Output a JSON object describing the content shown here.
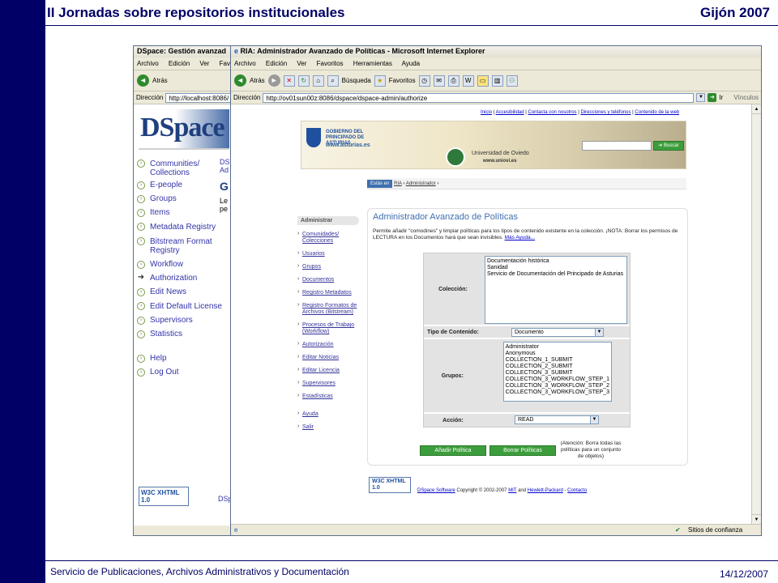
{
  "slide": {
    "title": "II Jornadas sobre repositorios institucionales",
    "city": "Gijón 2007",
    "footer_left": "Servicio de Publicaciones, Archivos Administrativos y Documentación",
    "footer_date": "14/12/2007"
  },
  "back_window": {
    "title": "DSpace: Gestión avanzad",
    "menu": [
      "Archivo",
      "Edición",
      "Ver",
      "Favorito"
    ],
    "back_label": "Atrás",
    "address_label": "Dirección",
    "address": "http://localhost:8086/",
    "logo": "DSpace",
    "nav": [
      "Communities/ Collections",
      "E-people",
      "Groups",
      "Items",
      "Metadata Registry",
      "Bitstream Format Registry",
      "Workflow",
      "Authorization",
      "Edit News",
      "Edit Default License",
      "Supervisors",
      "Statistics",
      "Help",
      "Log Out"
    ],
    "content_ds": "DS",
    "content_ad": "Ad",
    "content_g": "G",
    "content_le": "Le",
    "content_pe": "pe",
    "w3c_badge": "W3C XHTML 1.0",
    "footer_link": "DSp"
  },
  "front_window": {
    "title": "RIA: Administrador Avanzado de Políticas - Microsoft Internet Explorer",
    "menu": [
      "Archivo",
      "Edición",
      "Ver",
      "Favoritos",
      "Herramientas",
      "Ayuda"
    ],
    "back_label": "Atrás",
    "search_label": "Búsqueda",
    "favorites_label": "Favoritos",
    "address_label": "Dirección",
    "address": "http://ov01sun00z:8086/dspace/dspace-admin/authorize",
    "go_label": "Ir",
    "links_label": "Vínculos",
    "status_text": "Sitios de confianza",
    "toplinks": [
      "Inicio",
      "Accesibilidad",
      "Contacta con nosotros",
      "Direcciones y teléfonos",
      "Contenido de la web"
    ],
    "gov_logo": "GOBIERNO DEL PRINCIPADO DE ASTURIAS",
    "gov_url": "www.asturias.es",
    "uni_logo": "Universidad de Oviedo",
    "uni_url": "www.uniovi.es",
    "search_button": "Buscar",
    "breadcrumb": {
      "label": "Estás en",
      "items": [
        "RIA",
        "Administrador"
      ]
    },
    "sidebar_title": "Administrar",
    "sidebar": [
      "Comunidades/ Colecciones",
      "Usuarios",
      "Grupos",
      "Documentos",
      "Registro Metadatos",
      "Registro Formatos de Archivos (Bitstream)",
      "Procesos de Trabajo (Workflow)",
      "Autorización",
      "Editar Noticias",
      "Editar Licencia",
      "Supervisores",
      "Estadísticas",
      "Ayuda",
      "Salir"
    ],
    "page_heading": "Administrador Avanzado de Políticas",
    "intro": "Permite añadir \"comodines\" y limpiar políticas para los tipos de contenido existente en la colección. ¡NOTA: Borrar los permisos de LECTURA en los Documentos hará que sean invisibles.",
    "more_help": "Más Ayuda...",
    "form": {
      "collection_label": "Colección:",
      "collections": [
        "Documentación histórica",
        "Sanidad",
        "Servicio de Documentación del Principado de Asturias"
      ],
      "content_type_label": "Tipo de Contenido:",
      "content_type_value": "Documento",
      "groups_label": "Grupos:",
      "groups": [
        "Administrator",
        "Anonymous",
        "COLLECTION_1_SUBMIT",
        "COLLECTION_2_SUBMIT",
        "COLLECTION_3_SUBMIT",
        "COLLECTION_3_WORKFLOW_STEP_1",
        "COLLECTION_3_WORKFLOW_STEP_2",
        "COLLECTION_3_WORKFLOW_STEP_3"
      ],
      "action_label": "Acción:",
      "action_value": "READ",
      "add_button": "Añadir Política",
      "delete_button": "Borrar Políticas",
      "warning": "(Atención: Borra todas las políticas para un conjunto de objetos)"
    },
    "w3c_badge": "W3C XHTML 1.0",
    "footer": {
      "dspace_link": "DSpace Software",
      "copyright": "Copyright © 2002-2007",
      "mit": "MIT",
      "and": "and",
      "hp": "Hewlett-Packard",
      "dash": "-",
      "contact": "Contacto"
    }
  },
  "colors": {
    "slide_navy": "#000066",
    "ria_green": "#3c9d3c",
    "link_blue": "#0000cc"
  }
}
